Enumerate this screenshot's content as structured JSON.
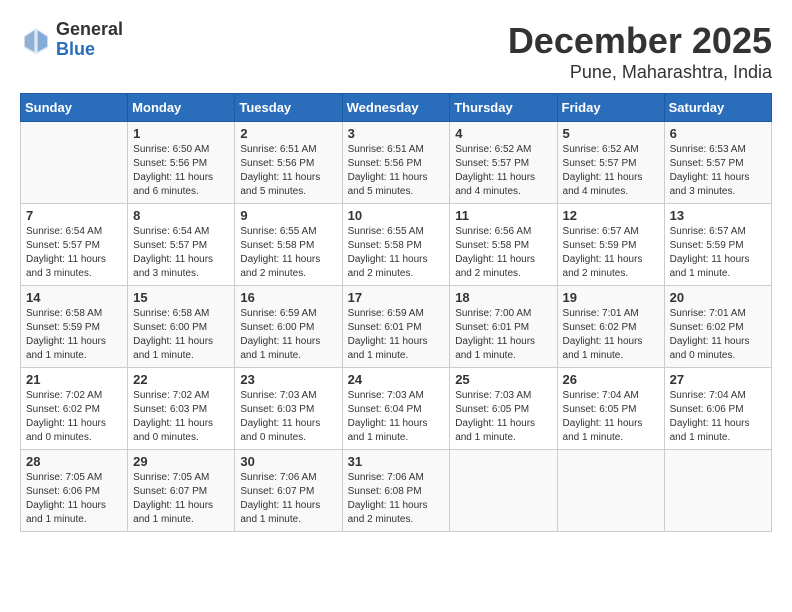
{
  "logo": {
    "general": "General",
    "blue": "Blue"
  },
  "title": "December 2025",
  "subtitle": "Pune, Maharashtra, India",
  "headers": [
    "Sunday",
    "Monday",
    "Tuesday",
    "Wednesday",
    "Thursday",
    "Friday",
    "Saturday"
  ],
  "weeks": [
    [
      {
        "day": "",
        "sunrise": "",
        "sunset": "",
        "daylight": ""
      },
      {
        "day": "1",
        "sunrise": "Sunrise: 6:50 AM",
        "sunset": "Sunset: 5:56 PM",
        "daylight": "Daylight: 11 hours and 6 minutes."
      },
      {
        "day": "2",
        "sunrise": "Sunrise: 6:51 AM",
        "sunset": "Sunset: 5:56 PM",
        "daylight": "Daylight: 11 hours and 5 minutes."
      },
      {
        "day": "3",
        "sunrise": "Sunrise: 6:51 AM",
        "sunset": "Sunset: 5:56 PM",
        "daylight": "Daylight: 11 hours and 5 minutes."
      },
      {
        "day": "4",
        "sunrise": "Sunrise: 6:52 AM",
        "sunset": "Sunset: 5:57 PM",
        "daylight": "Daylight: 11 hours and 4 minutes."
      },
      {
        "day": "5",
        "sunrise": "Sunrise: 6:52 AM",
        "sunset": "Sunset: 5:57 PM",
        "daylight": "Daylight: 11 hours and 4 minutes."
      },
      {
        "day": "6",
        "sunrise": "Sunrise: 6:53 AM",
        "sunset": "Sunset: 5:57 PM",
        "daylight": "Daylight: 11 hours and 3 minutes."
      }
    ],
    [
      {
        "day": "7",
        "sunrise": "Sunrise: 6:54 AM",
        "sunset": "Sunset: 5:57 PM",
        "daylight": "Daylight: 11 hours and 3 minutes."
      },
      {
        "day": "8",
        "sunrise": "Sunrise: 6:54 AM",
        "sunset": "Sunset: 5:57 PM",
        "daylight": "Daylight: 11 hours and 3 minutes."
      },
      {
        "day": "9",
        "sunrise": "Sunrise: 6:55 AM",
        "sunset": "Sunset: 5:58 PM",
        "daylight": "Daylight: 11 hours and 2 minutes."
      },
      {
        "day": "10",
        "sunrise": "Sunrise: 6:55 AM",
        "sunset": "Sunset: 5:58 PM",
        "daylight": "Daylight: 11 hours and 2 minutes."
      },
      {
        "day": "11",
        "sunrise": "Sunrise: 6:56 AM",
        "sunset": "Sunset: 5:58 PM",
        "daylight": "Daylight: 11 hours and 2 minutes."
      },
      {
        "day": "12",
        "sunrise": "Sunrise: 6:57 AM",
        "sunset": "Sunset: 5:59 PM",
        "daylight": "Daylight: 11 hours and 2 minutes."
      },
      {
        "day": "13",
        "sunrise": "Sunrise: 6:57 AM",
        "sunset": "Sunset: 5:59 PM",
        "daylight": "Daylight: 11 hours and 1 minute."
      }
    ],
    [
      {
        "day": "14",
        "sunrise": "Sunrise: 6:58 AM",
        "sunset": "Sunset: 5:59 PM",
        "daylight": "Daylight: 11 hours and 1 minute."
      },
      {
        "day": "15",
        "sunrise": "Sunrise: 6:58 AM",
        "sunset": "Sunset: 6:00 PM",
        "daylight": "Daylight: 11 hours and 1 minute."
      },
      {
        "day": "16",
        "sunrise": "Sunrise: 6:59 AM",
        "sunset": "Sunset: 6:00 PM",
        "daylight": "Daylight: 11 hours and 1 minute."
      },
      {
        "day": "17",
        "sunrise": "Sunrise: 6:59 AM",
        "sunset": "Sunset: 6:01 PM",
        "daylight": "Daylight: 11 hours and 1 minute."
      },
      {
        "day": "18",
        "sunrise": "Sunrise: 7:00 AM",
        "sunset": "Sunset: 6:01 PM",
        "daylight": "Daylight: 11 hours and 1 minute."
      },
      {
        "day": "19",
        "sunrise": "Sunrise: 7:01 AM",
        "sunset": "Sunset: 6:02 PM",
        "daylight": "Daylight: 11 hours and 1 minute."
      },
      {
        "day": "20",
        "sunrise": "Sunrise: 7:01 AM",
        "sunset": "Sunset: 6:02 PM",
        "daylight": "Daylight: 11 hours and 0 minutes."
      }
    ],
    [
      {
        "day": "21",
        "sunrise": "Sunrise: 7:02 AM",
        "sunset": "Sunset: 6:02 PM",
        "daylight": "Daylight: 11 hours and 0 minutes."
      },
      {
        "day": "22",
        "sunrise": "Sunrise: 7:02 AM",
        "sunset": "Sunset: 6:03 PM",
        "daylight": "Daylight: 11 hours and 0 minutes."
      },
      {
        "day": "23",
        "sunrise": "Sunrise: 7:03 AM",
        "sunset": "Sunset: 6:03 PM",
        "daylight": "Daylight: 11 hours and 0 minutes."
      },
      {
        "day": "24",
        "sunrise": "Sunrise: 7:03 AM",
        "sunset": "Sunset: 6:04 PM",
        "daylight": "Daylight: 11 hours and 1 minute."
      },
      {
        "day": "25",
        "sunrise": "Sunrise: 7:03 AM",
        "sunset": "Sunset: 6:05 PM",
        "daylight": "Daylight: 11 hours and 1 minute."
      },
      {
        "day": "26",
        "sunrise": "Sunrise: 7:04 AM",
        "sunset": "Sunset: 6:05 PM",
        "daylight": "Daylight: 11 hours and 1 minute."
      },
      {
        "day": "27",
        "sunrise": "Sunrise: 7:04 AM",
        "sunset": "Sunset: 6:06 PM",
        "daylight": "Daylight: 11 hours and 1 minute."
      }
    ],
    [
      {
        "day": "28",
        "sunrise": "Sunrise: 7:05 AM",
        "sunset": "Sunset: 6:06 PM",
        "daylight": "Daylight: 11 hours and 1 minute."
      },
      {
        "day": "29",
        "sunrise": "Sunrise: 7:05 AM",
        "sunset": "Sunset: 6:07 PM",
        "daylight": "Daylight: 11 hours and 1 minute."
      },
      {
        "day": "30",
        "sunrise": "Sunrise: 7:06 AM",
        "sunset": "Sunset: 6:07 PM",
        "daylight": "Daylight: 11 hours and 1 minute."
      },
      {
        "day": "31",
        "sunrise": "Sunrise: 7:06 AM",
        "sunset": "Sunset: 6:08 PM",
        "daylight": "Daylight: 11 hours and 2 minutes."
      },
      {
        "day": "",
        "sunrise": "",
        "sunset": "",
        "daylight": ""
      },
      {
        "day": "",
        "sunrise": "",
        "sunset": "",
        "daylight": ""
      },
      {
        "day": "",
        "sunrise": "",
        "sunset": "",
        "daylight": ""
      }
    ]
  ]
}
